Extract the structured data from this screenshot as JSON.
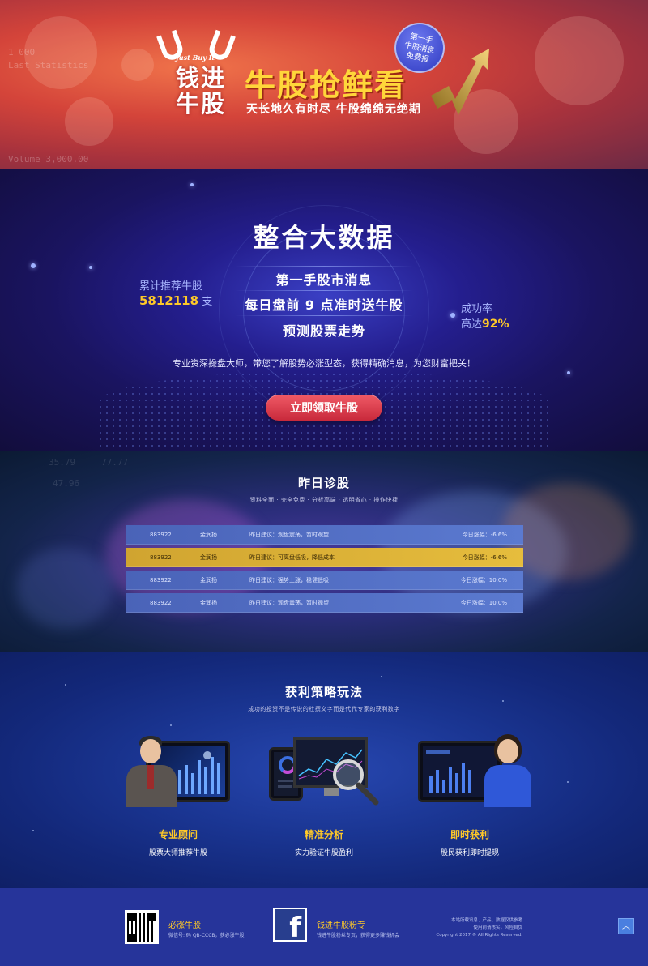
{
  "hero": {
    "logo_tagline": "Just Buy It",
    "logo_line1": "钱进",
    "logo_line2": "牛股",
    "title": "牛股抢鲜看",
    "subtitle": "天长地久有时尽  牛股绵绵无绝期",
    "badge_line1": "第一手",
    "badge_line2": "牛股消息",
    "badge_line3": "免费报",
    "bg_ticker_1": "1 000",
    "bg_ticker_2": "Last Statistics",
    "bg_ticker_3": "Volume  3,000.00"
  },
  "bigdata": {
    "title": "整合大数据",
    "line1": "第一手股市消息",
    "line2": "每日盘前 9 点准时送牛股",
    "line3": "预测股票走势",
    "left_label": "累计推荐牛股",
    "left_value": "5812118",
    "left_unit": "支",
    "right_label": "成功率",
    "right_prefix": "高达",
    "right_value": "92%",
    "description": "专业资深操盘大师，带您了解股势必涨型态，获得精确消息，为您财富把关！",
    "cta_label": "立即领取牛股"
  },
  "yesterday": {
    "title": "昨日诊股",
    "subtitle": "资料全面 · 完全免费 · 分析高端 · 透明省心 · 操作快捷",
    "bg_numbers": [
      "35.79",
      "77.77",
      "47.96"
    ],
    "rows": [
      {
        "code": "883922",
        "name": "金润扬",
        "advice": "昨日建议：观盘震荡，暂时观望",
        "change": "今日涨幅：-6.6%",
        "highlight": false
      },
      {
        "code": "883922",
        "name": "金润扬",
        "advice": "昨日建议：可离盘低吸，降低成本",
        "change": "今日涨幅：-6.6%",
        "highlight": true
      },
      {
        "code": "883922",
        "name": "金润扬",
        "advice": "昨日建议：强势上涨，稳健低吸",
        "change": "今日涨幅：10.0%",
        "highlight": false
      },
      {
        "code": "883922",
        "name": "金润扬",
        "advice": "昨日建议：观盘震荡，暂时观望",
        "change": "今日涨幅：10.0%",
        "highlight": false
      }
    ]
  },
  "strategy": {
    "title": "获利策略玩法",
    "subtitle": "成功的投资不是传说的杜撰文字而是代代专家的获利数字",
    "features": [
      {
        "title": "专业顾问",
        "desc": "股票大师推荐牛股"
      },
      {
        "title": "精准分析",
        "desc": "实力验证牛股盈利"
      },
      {
        "title": "即时获利",
        "desc": "股民获利即时提现"
      }
    ]
  },
  "footer": {
    "col1_title": "必涨牛股",
    "col1_desc": "微信号: 码 QB-CCCB，获必涨牛股",
    "col2_title": "钱进牛股粉专",
    "col2_desc": "钱进牛股粉丝专页，获得更多赚钱机会",
    "right_line1": "本站所载讯息、产品、数据仅供参考",
    "right_line2": "使用前请核实，风险自负",
    "right_line3": "Copyright 2017 © All Rights Reserved.",
    "totop_icon": "chevron-up-icon"
  }
}
